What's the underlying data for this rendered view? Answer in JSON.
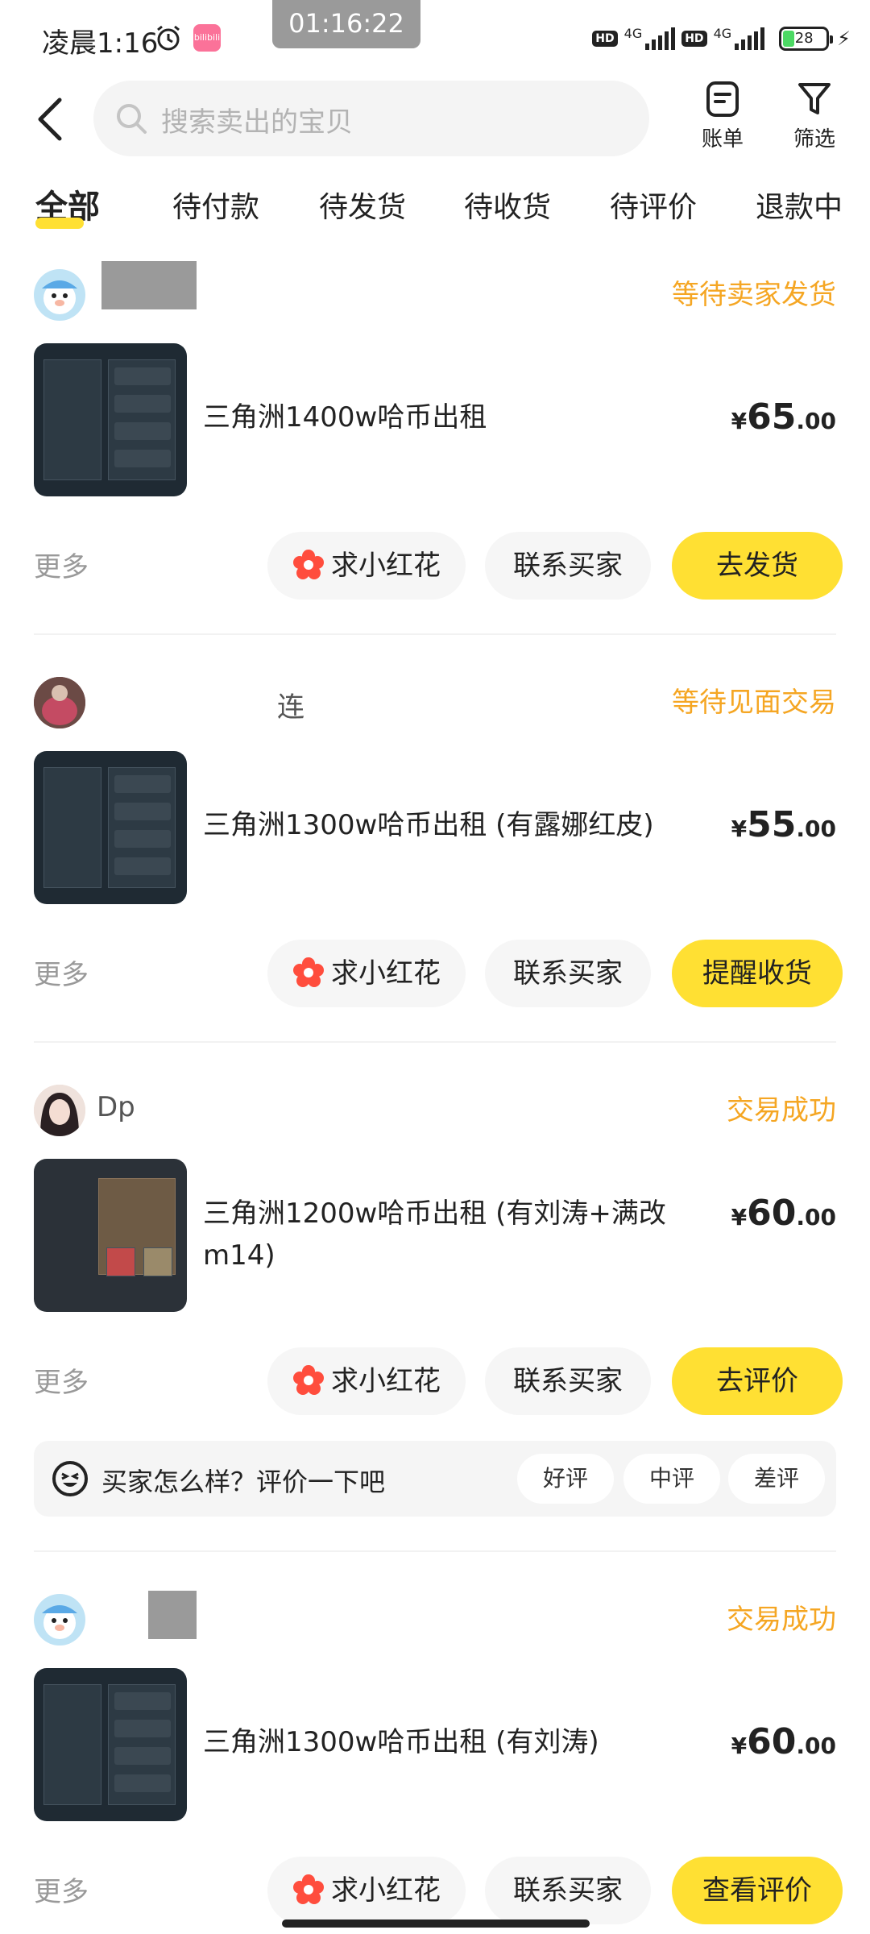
{
  "status_bar": {
    "time": "凌晨1:16",
    "recording_timer": "01:16:22",
    "app_badge": "bilibili",
    "hd1": "HD",
    "net1": "4G",
    "hd2": "HD",
    "net2": "4G",
    "battery": "28",
    "battery_level": 0.28
  },
  "header": {
    "search_placeholder": "搜索卖出的宝贝",
    "bill_label": "账单",
    "filter_label": "筛选"
  },
  "tabs": [
    {
      "label": "全部",
      "active": true
    },
    {
      "label": "待付款"
    },
    {
      "label": "待发货"
    },
    {
      "label": "待收货"
    },
    {
      "label": "待评价"
    },
    {
      "label": "退款中"
    }
  ],
  "orders": [
    {
      "buyer_name": "",
      "status": "等待卖家发货",
      "title": "三角洲1400w哈币出租",
      "price_symbol": "¥",
      "price_int": "65",
      "price_dec": ".00",
      "more": "更多",
      "btn_flower": "求小红花",
      "btn_contact": "联系买家",
      "btn_primary": "去发货"
    },
    {
      "buyer_name": "连",
      "status": "等待见面交易",
      "title": "三角洲1300w哈币出租 (有露娜红皮)",
      "price_symbol": "¥",
      "price_int": "55",
      "price_dec": ".00",
      "more": "更多",
      "btn_flower": "求小红花",
      "btn_contact": "联系买家",
      "btn_primary": "提醒收货"
    },
    {
      "buyer_name": "Dp",
      "status": "交易成功",
      "title": "三角洲1200w哈币出租 (有刘涛+满改m14)",
      "price_symbol": "¥",
      "price_int": "60",
      "price_dec": ".00",
      "more": "更多",
      "btn_flower": "求小红花",
      "btn_contact": "联系买家",
      "btn_primary": "去评价",
      "review": {
        "prompt": "买家怎么样？评价一下吧",
        "options": [
          "好评",
          "中评",
          "差评"
        ]
      }
    },
    {
      "buyer_name": "",
      "status": "交易成功",
      "title": "三角洲1300w哈币出租 (有刘涛)",
      "price_symbol": "¥",
      "price_int": "60",
      "price_dec": ".00",
      "more": "更多",
      "btn_flower": "求小红花",
      "btn_contact": "联系买家",
      "btn_primary": "查看评价"
    }
  ],
  "colors": {
    "accent_yellow": "#ffe033",
    "status_orange": "#f5a623",
    "flower_red": "#ff4d3d"
  },
  "icons": [
    "alarm-icon",
    "back-icon",
    "search-icon",
    "bill-icon",
    "filter-icon",
    "flower-icon",
    "review-emoji-icon"
  ]
}
